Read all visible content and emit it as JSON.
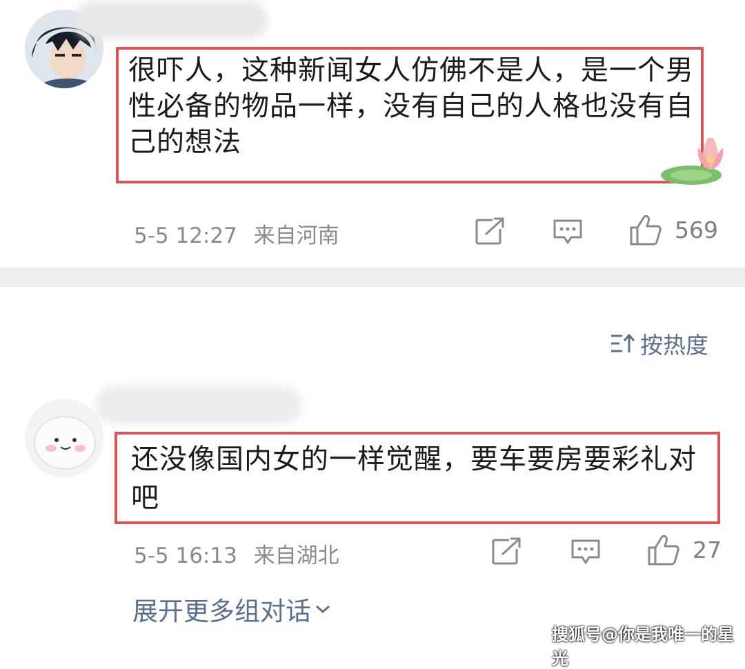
{
  "comments": [
    {
      "text": "很吓人，这种新闻女人仿佛不是人，是一个男性必备的物品一样，没有自己的人格也没有自己的想法",
      "time": "5-5 12:27",
      "location": "来自河南",
      "likes": "569"
    },
    {
      "text": "还没像国内女的一样觉醒，要车要房要彩礼对吧",
      "time": "5-5 16:13",
      "location": "来自湖北",
      "likes": "27"
    }
  ],
  "sort": {
    "label": "按热度"
  },
  "expand": {
    "label": "展开更多组对话"
  },
  "watermark": "搜狐号@你是我唯一的星光",
  "colors": {
    "highlight": "#d9545a",
    "link": "#5b6f8e",
    "meta": "#8a8a8a"
  },
  "icons": [
    "share-icon",
    "comment-icon",
    "like-icon",
    "sort-icon",
    "chevron-down-icon",
    "lotus-sticker"
  ]
}
